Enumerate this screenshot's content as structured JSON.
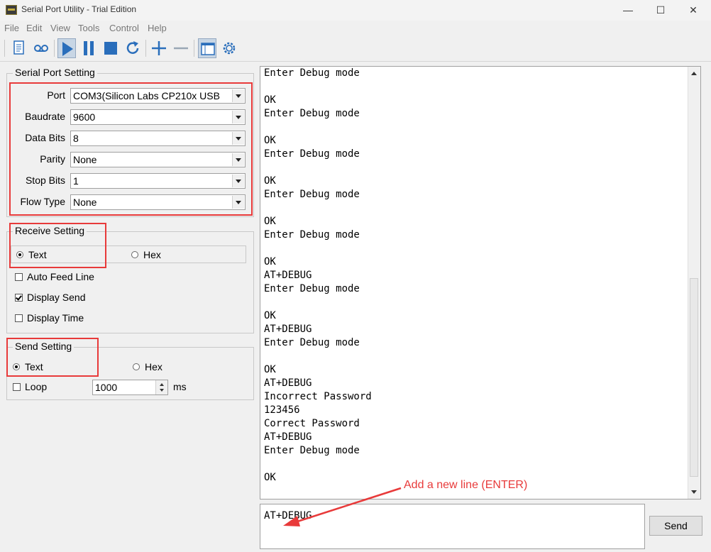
{
  "window": {
    "title": "Serial Port Utility - Trial Edition",
    "minimize": "—",
    "maximize": "☐",
    "close": "✕"
  },
  "menu": [
    "File",
    "Edit",
    "View",
    "Tools",
    "Control",
    "Help"
  ],
  "toolbar": {
    "icons": [
      "document-icon",
      "record-icon",
      "play-icon",
      "pause-icon",
      "stop-icon",
      "refresh-icon",
      "add-icon",
      "remove-icon",
      "window-icon",
      "settings-icon"
    ],
    "accent_color": "#2a6ebb"
  },
  "serial_port_setting": {
    "title": "Serial Port Setting",
    "port": {
      "label": "Port",
      "value": "COM3(Silicon Labs CP210x USB"
    },
    "baudrate": {
      "label": "Baudrate",
      "value": "9600"
    },
    "data_bits": {
      "label": "Data Bits",
      "value": "8"
    },
    "parity": {
      "label": "Parity",
      "value": "None"
    },
    "stop_bits": {
      "label": "Stop Bits",
      "value": "1"
    },
    "flow_type": {
      "label": "Flow Type",
      "value": "None"
    }
  },
  "receive_setting": {
    "title": "Receive Setting",
    "text_label": "Text",
    "hex_label": "Hex",
    "selected": "Text",
    "auto_feed_line": {
      "label": "Auto Feed Line",
      "checked": false
    },
    "display_send": {
      "label": "Display Send",
      "checked": true
    },
    "display_time": {
      "label": "Display Time",
      "checked": false
    }
  },
  "send_setting": {
    "title": "Send Setting",
    "text_label": "Text",
    "hex_label": "Hex",
    "selected": "Text",
    "loop": {
      "label": "Loop",
      "checked": false
    },
    "interval_value": "1000",
    "interval_unit": "ms"
  },
  "terminal": {
    "lines": [
      "Enter Debug mode",
      "",
      "OK",
      "Enter Debug mode",
      "",
      "OK",
      "Enter Debug mode",
      "",
      "OK",
      "Enter Debug mode",
      "",
      "OK",
      "Enter Debug mode",
      "",
      "OK",
      "AT+DEBUG",
      "Enter Debug mode",
      "",
      "OK",
      "AT+DEBUG",
      "Enter Debug mode",
      "",
      "OK",
      "AT+DEBUG",
      "Incorrect Password",
      "123456",
      "Correct Password",
      "AT+DEBUG",
      "Enter Debug mode",
      "",
      "OK"
    ]
  },
  "send_input": {
    "value": "AT+DEBUG"
  },
  "send_button": "Send",
  "annotation": {
    "text": "Add a new line (ENTER)",
    "color": "#e83a3a"
  }
}
